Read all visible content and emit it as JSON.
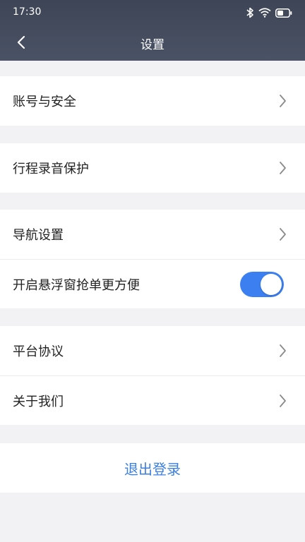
{
  "status_bar": {
    "time": "17:30",
    "icons": [
      "bluetooth-icon",
      "wifi-icon",
      "battery-icon"
    ]
  },
  "nav": {
    "title": "设置",
    "back_icon": "chevron-left-icon"
  },
  "groups": [
    {
      "items": [
        {
          "label": "账号与安全",
          "type": "link"
        }
      ]
    },
    {
      "items": [
        {
          "label": "行程录音保护",
          "type": "link"
        }
      ]
    },
    {
      "items": [
        {
          "label": "导航设置",
          "type": "link"
        },
        {
          "label": "开启悬浮窗抢单更方便",
          "type": "toggle",
          "value": true
        }
      ]
    },
    {
      "items": [
        {
          "label": "平台协议",
          "type": "link"
        },
        {
          "label": "关于我们",
          "type": "link"
        }
      ]
    }
  ],
  "logout": {
    "label": "退出登录"
  },
  "colors": {
    "header": "#434b5d",
    "background": "#f2f2f4",
    "accent": "#3b7ff0",
    "logout_text": "#3b7fe0",
    "chevron": "#8a8a8a"
  }
}
